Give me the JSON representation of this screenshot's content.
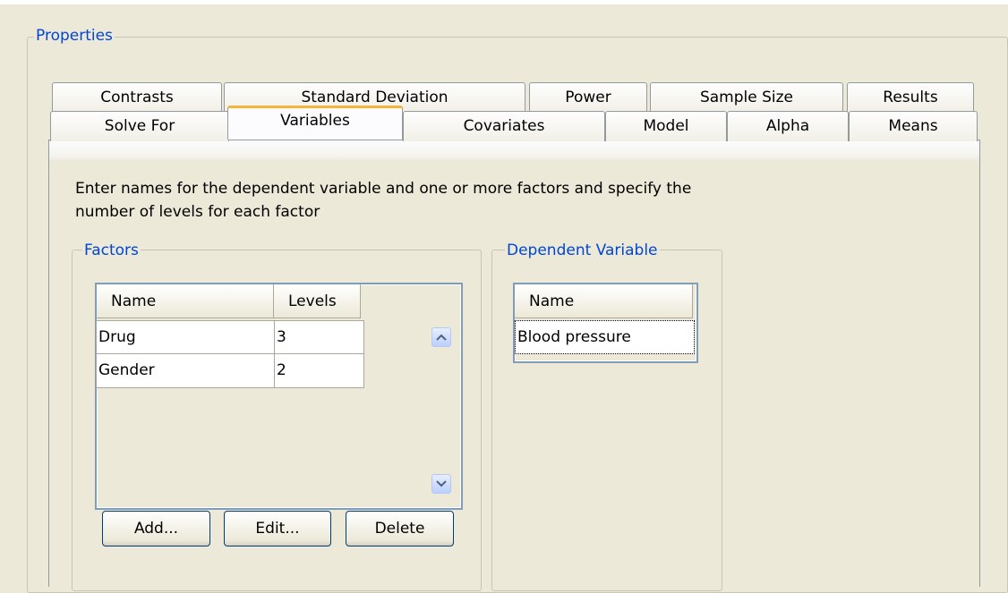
{
  "properties_group": {
    "title": "Properties"
  },
  "tabs_row1": [
    {
      "label": "Contrasts"
    },
    {
      "label": "Standard Deviation"
    },
    {
      "label": "Power"
    },
    {
      "label": "Sample Size"
    },
    {
      "label": "Results"
    }
  ],
  "tabs_row2": [
    {
      "label": "Solve For"
    },
    {
      "label": "Variables",
      "selected": true
    },
    {
      "label": "Covariates"
    },
    {
      "label": "Model"
    },
    {
      "label": "Alpha"
    },
    {
      "label": "Means"
    }
  ],
  "instructions": "Enter names for the dependent variable and one or more factors and specify the number of levels for each factor",
  "factors": {
    "title": "Factors",
    "columns": [
      "Name",
      "Levels"
    ],
    "rows": [
      {
        "name": "Drug",
        "levels": "3"
      },
      {
        "name": "Gender",
        "levels": "2"
      }
    ],
    "buttons": {
      "add": "Add...",
      "edit": "Edit...",
      "delete": "Delete"
    }
  },
  "dependent_variable": {
    "title": "Dependent Variable",
    "columns": [
      "Name"
    ],
    "rows": [
      {
        "name": "Blood pressure"
      }
    ]
  },
  "icons": {
    "scroll_up": "chevron-up-icon",
    "scroll_down": "chevron-down-icon"
  },
  "colors": {
    "group_title": "#0046d5",
    "tab_highlight": "#f8b33a",
    "background": "#ece9d8"
  }
}
